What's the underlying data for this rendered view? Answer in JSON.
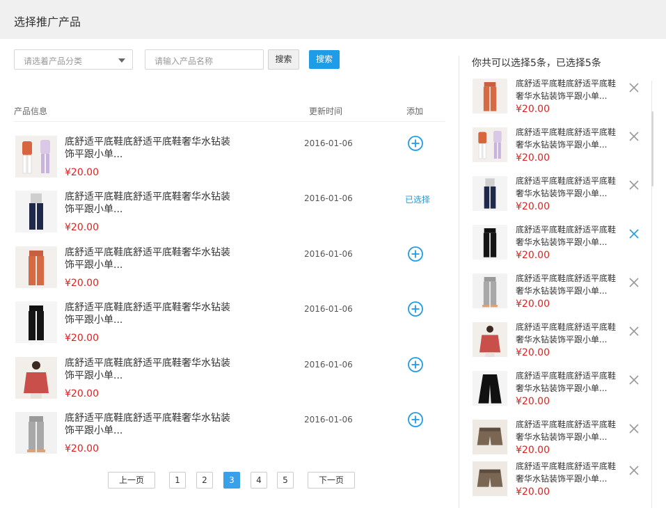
{
  "header": {
    "title": "选择推广产品"
  },
  "toolbar": {
    "category_placeholder": "请选着产品分类",
    "search_placeholder": "请输入产品名称",
    "search_button_1": "搜索",
    "search_button_2": "搜索"
  },
  "table": {
    "col_info": "产品信息",
    "col_time": "更新时间",
    "col_add": "添加",
    "rows": [
      {
        "name": "底舒适平底鞋底舒适平底鞋奢华水钻装饰平跟小单...",
        "price": "¥20.00",
        "date": "2016-01-06",
        "status": "add",
        "image": "orange-top-outfit"
      },
      {
        "name": "底舒适平底鞋底舒适平底鞋奢华水钻装饰平跟小单...",
        "price": "¥20.00",
        "date": "2016-01-06",
        "status": "chosen",
        "status_text": "已选择",
        "image": "navy-pants"
      },
      {
        "name": "底舒适平底鞋底舒适平底鞋奢华水钻装饰平跟小单...",
        "price": "¥20.00",
        "date": "2016-01-06",
        "status": "add",
        "image": "orange-pants"
      },
      {
        "name": "底舒适平底鞋底舒适平底鞋奢华水钻装饰平跟小单...",
        "price": "¥20.00",
        "date": "2016-01-06",
        "status": "add",
        "image": "black-pants"
      },
      {
        "name": "底舒适平底鞋底舒适平底鞋奢华水钻装饰平跟小单...",
        "price": "¥20.00",
        "date": "2016-01-06",
        "status": "add",
        "image": "red-top"
      },
      {
        "name": "底舒适平底鞋底舒适平底鞋奢华水钻装饰平跟小单...",
        "price": "¥20.00",
        "date": "2016-01-06",
        "status": "add",
        "image": "gray-pants"
      }
    ]
  },
  "pagination": {
    "prev": "上一页",
    "next": "下一页",
    "pages": [
      "1",
      "2",
      "3",
      "4",
      "5"
    ],
    "current": "3"
  },
  "panel": {
    "title": "你共可以选择5条，已选择5条",
    "items": [
      {
        "name": "底舒适平底鞋底舒适平底鞋奢华水钻装饰平跟小单...",
        "price": "¥20.00",
        "image": "orange-pants",
        "close_active": false
      },
      {
        "name": "底舒适平底鞋底舒适平底鞋奢华水钻装饰平跟小单...",
        "price": "¥20.00",
        "image": "orange-top-outfit",
        "close_active": false
      },
      {
        "name": "底舒适平底鞋底舒适平底鞋奢华水钻装饰平跟小单...",
        "price": "¥20.00",
        "image": "navy-pants",
        "close_active": false
      },
      {
        "name": "底舒适平底鞋底舒适平底鞋奢华水钻装饰平跟小单...",
        "price": "¥20.00",
        "image": "black-pants",
        "close_active": true
      },
      {
        "name": "底舒适平底鞋底舒适平底鞋奢华水钻装饰平跟小单...",
        "price": "¥20.00",
        "image": "gray-pants",
        "close_active": false
      },
      {
        "name": "底舒适平底鞋底舒适平底鞋奢华水钻装饰平跟小单...",
        "price": "¥20.00",
        "image": "red-top",
        "close_active": false
      },
      {
        "name": "底舒适平底鞋底舒适平底鞋奢华水钻装饰平跟小单...",
        "price": "¥20.00",
        "image": "black-wide-pants",
        "close_active": false
      },
      {
        "name": "底舒适平底鞋底舒适平底鞋奢华水钻装饰平跟小单...",
        "price": "¥20.00",
        "image": "brown-shorts",
        "close_active": false
      },
      {
        "name": "底舒适平底鞋底舒适平底鞋奢华水钻装饰平跟小单...",
        "price": "¥20.00",
        "image": "brown-shorts",
        "close_active": false
      }
    ]
  },
  "colors": {
    "accent": "#1e9ce6",
    "price": "#e02020",
    "header_bg": "#f0f0f0"
  }
}
